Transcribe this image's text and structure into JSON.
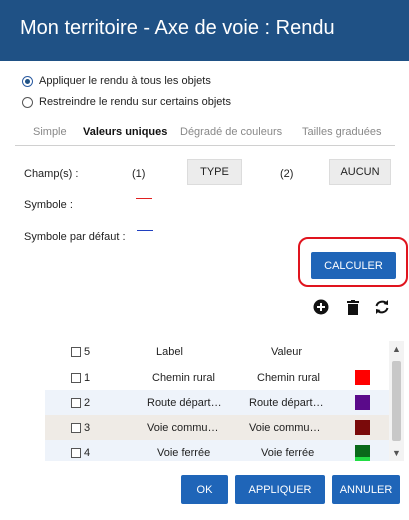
{
  "window": {
    "title": "Mon territoire - Axe de voie : Rendu"
  },
  "scope": {
    "option_all": "Appliquer le rendu à tous les objets",
    "option_some": "Restreindre le rendu sur certains objets",
    "selected": "all"
  },
  "tabs": [
    "Simple",
    "Valeurs uniques",
    "Dégradé de couleurs",
    "Tailles graduées"
  ],
  "active_tab": "Valeurs uniques",
  "fields": {
    "label": "Champ(s) :",
    "slot1_index": "(1)",
    "slot1_value": "TYPE",
    "slot2_index": "(2)",
    "slot2_value": "AUCUN"
  },
  "symbol": {
    "label": "Symbole :",
    "color": "#e02020"
  },
  "default_symbol": {
    "label": "Symbole par défaut :",
    "color": "#2040c0"
  },
  "calculate_button": "CALCULER",
  "toolbar": {
    "add": "plus-circle-icon",
    "delete": "trash-icon",
    "refresh": "refresh-icon"
  },
  "table": {
    "header": {
      "count": "5",
      "label": "Label",
      "value": "Valeur"
    },
    "rows": [
      {
        "num": "1",
        "label": "Chemin rural",
        "value": "Chemin rural",
        "color": "#ff0000"
      },
      {
        "num": "2",
        "label": "Route départ…",
        "value": "Route départ…",
        "color": "#5a0a8a"
      },
      {
        "num": "3",
        "label": "Voie commu…",
        "value": "Voie commu…",
        "color": "#7a0a0a"
      },
      {
        "num": "4",
        "label": "Voie ferrée",
        "value": "Voie ferrée",
        "color": "#0a6a1a"
      }
    ],
    "partial_color": "#22dd44"
  },
  "footer": {
    "ok": "OK",
    "apply": "APPLIQUER",
    "cancel": "ANNULER"
  },
  "colors": {
    "title_bar": "#1f5185",
    "primary_button": "#1f65b8",
    "highlight": "#e0141e"
  }
}
